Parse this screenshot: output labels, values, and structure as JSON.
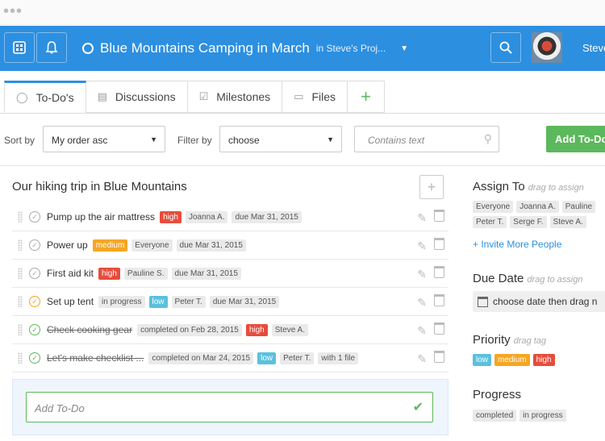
{
  "window": {
    "dots": "•••"
  },
  "header": {
    "project_title": "Blue Mountains Camping in March",
    "project_sub": "in Steve's Proj...",
    "username": "Steve"
  },
  "tabs": [
    {
      "label": "To-Do's",
      "icon": "check-circle-icon",
      "active": true
    },
    {
      "label": "Discussions",
      "icon": "chat-icon"
    },
    {
      "label": "Milestones",
      "icon": "checkbox-icon"
    },
    {
      "label": "Files",
      "icon": "folder-icon"
    }
  ],
  "toolbar": {
    "sort_label": "Sort by",
    "sort_value": "My order asc",
    "filter_label": "Filter by",
    "filter_value": "choose",
    "search_placeholder": "Contains text",
    "add_button": "Add To-Do"
  },
  "list": {
    "title": "Our hiking trip in Blue Mountains",
    "add_placeholder": "Add To-Do",
    "items": [
      {
        "name": "Pump up the air mattress",
        "status": "open",
        "tags": [
          [
            "high",
            "high"
          ],
          [
            "Joanna A.",
            ""
          ],
          [
            "due Mar 31, 2015",
            ""
          ]
        ]
      },
      {
        "name": "Power up",
        "status": "open",
        "tags": [
          [
            "medium",
            "medium"
          ],
          [
            "Everyone",
            ""
          ],
          [
            "due Mar 31, 2015",
            ""
          ]
        ]
      },
      {
        "name": "First aid kit",
        "status": "open",
        "tags": [
          [
            "high",
            "high"
          ],
          [
            "Pauline S.",
            ""
          ],
          [
            "due Mar 31, 2015",
            ""
          ]
        ]
      },
      {
        "name": "Set up tent",
        "status": "progress",
        "tags": [
          [
            "in progress",
            ""
          ],
          [
            "low",
            "low"
          ],
          [
            "Peter T.",
            ""
          ],
          [
            "due Mar 31, 2015",
            ""
          ]
        ]
      },
      {
        "name": "Check cooking gear",
        "status": "done",
        "tags": [
          [
            "completed on Feb 28, 2015",
            ""
          ],
          [
            "high",
            "high"
          ],
          [
            "Steve A.",
            ""
          ]
        ]
      },
      {
        "name": "Let's make checklist ...",
        "status": "done",
        "tags": [
          [
            "completed on Mar 24, 2015",
            ""
          ],
          [
            "low",
            "low"
          ],
          [
            "Peter T.",
            ""
          ],
          [
            "with 1 file",
            ""
          ]
        ]
      }
    ]
  },
  "sidebar": {
    "assign": {
      "title": "Assign To",
      "hint": "drag to assign",
      "people": [
        "Everyone",
        "Joanna A.",
        "Pauline",
        "Peter T.",
        "Serge F.",
        "Steve A."
      ],
      "invite": "+ Invite More People"
    },
    "due": {
      "title": "Due Date",
      "hint": "drag to assign",
      "placeholder": "choose date then drag n"
    },
    "priority": {
      "title": "Priority",
      "hint": "drag tag",
      "tags": [
        "low",
        "medium",
        "high"
      ]
    },
    "progress": {
      "title": "Progress",
      "tags": [
        "completed",
        "in progress"
      ]
    }
  },
  "colors": {
    "brand": "#2d8fe0",
    "success": "#5cb85c",
    "high": "#e74c3c",
    "medium": "#f5a623",
    "low": "#5bc0de"
  }
}
